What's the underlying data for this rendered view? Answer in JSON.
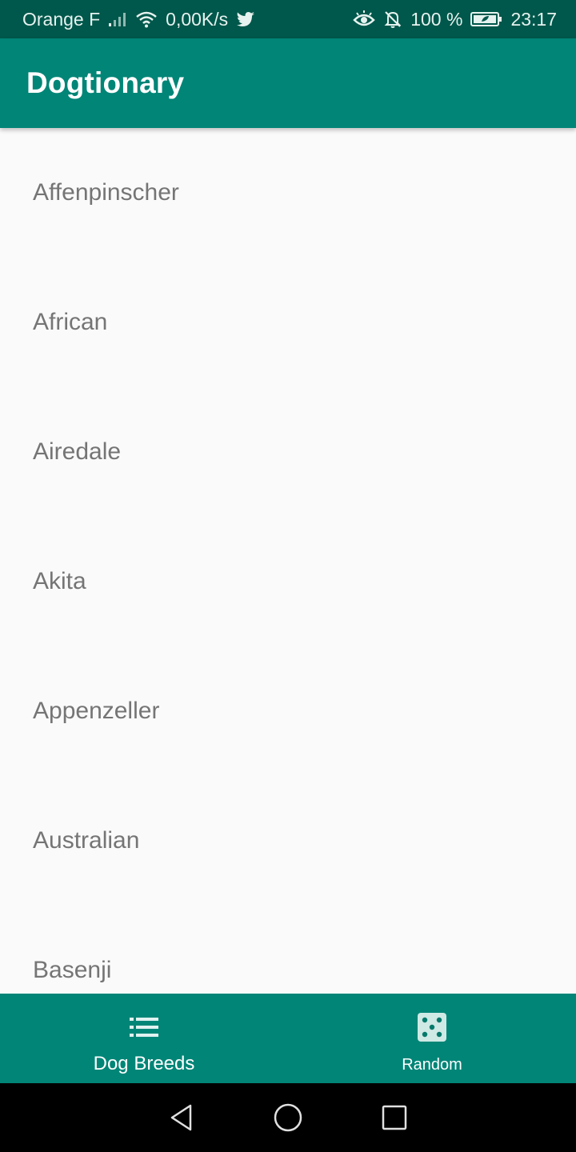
{
  "status_bar": {
    "carrier": "Orange F",
    "net_speed": "0,00K/s",
    "battery": "100 %",
    "time": "23:17",
    "icons": [
      "signal-icon",
      "wifi-icon",
      "twitter-icon",
      "eye-icon",
      "bell-off-icon",
      "battery-icon"
    ]
  },
  "app_bar": {
    "title": "Dogtionary",
    "color": "#008577"
  },
  "breeds": [
    {
      "label": "Affenpinscher"
    },
    {
      "label": "African"
    },
    {
      "label": "Airedale"
    },
    {
      "label": "Akita"
    },
    {
      "label": "Appenzeller"
    },
    {
      "label": "Australian"
    },
    {
      "label": "Basenji"
    }
  ],
  "bottom_nav": {
    "items": [
      {
        "label": "Dog Breeds",
        "icon": "list-icon",
        "active": true
      },
      {
        "label": "Random",
        "icon": "dice-icon",
        "active": false
      }
    ]
  },
  "system_nav": {
    "buttons": [
      "back-icon",
      "home-icon",
      "recents-icon"
    ]
  }
}
